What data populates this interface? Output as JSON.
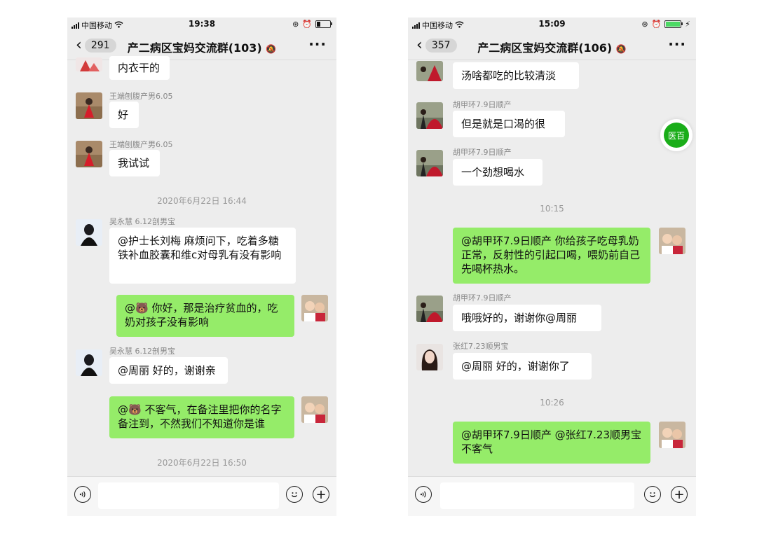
{
  "left": {
    "status": {
      "carrier": "中国移动",
      "time": "19:38"
    },
    "header": {
      "back_count": "291",
      "title": "产二病区宝妈交流群(103)"
    },
    "messages": [
      {
        "text": "内衣干的"
      },
      {
        "sender": "王端刨腹产男6.05",
        "text": "好"
      },
      {
        "sender": "王端刨腹产男6.05",
        "text": "我试试"
      },
      {
        "time": "2020年6月22日 16:44"
      },
      {
        "sender": "吴永慧  6.12剖男宝",
        "text": "@护士长刘梅 麻烦问下，吃着多糖铁补血胶囊和维c对母乳有没有影响"
      },
      {
        "text": "@🐻 你好，那是治疗贫血的，吃奶对孩子没有影响"
      },
      {
        "sender": "吴永慧  6.12剖男宝",
        "text": "@周丽 好的，谢谢亲"
      },
      {
        "text": "@🐻 不客气，在备注里把你的名字备注到，不然我们不知道你是谁"
      },
      {
        "time": "2020年6月22日 16:50"
      }
    ]
  },
  "right": {
    "status": {
      "carrier": "中国移动",
      "time": "15:09"
    },
    "header": {
      "back_count": "357",
      "title": "产二病区宝妈交流群(106)"
    },
    "float_button": "医百",
    "messages": [
      {
        "text": "汤啥都吃的比较清淡"
      },
      {
        "sender": "胡甲环7.9日顺产",
        "text": "但是就是口渴的很"
      },
      {
        "sender": "胡甲环7.9日顺产",
        "text": "一个劲想喝水"
      },
      {
        "time": "10:15"
      },
      {
        "text": "@胡甲环7.9日顺产 你给孩子吃母乳奶正常，反射性的引起口喝，喂奶前自己先喝杯热水。"
      },
      {
        "sender": "胡甲环7.9日顺产",
        "text": "哦哦好的，谢谢你@周丽"
      },
      {
        "sender": "张红7.23顺男宝",
        "text": "@周丽 好的，谢谢你了"
      },
      {
        "time": "10:26"
      },
      {
        "text": "@胡甲环7.9日顺产 @张红7.23顺男宝 不客气"
      }
    ]
  },
  "icons": {
    "voice": "voice-icon",
    "emoji": "emoji-icon",
    "plus": "plus-icon",
    "back": "chevron-left-icon",
    "more": "more-icon",
    "mute": "mute-bell-icon"
  },
  "colors": {
    "outgoing_bubble": "#95ec69",
    "incoming_bubble": "#ffffff",
    "chat_bg": "#ededed",
    "float_button": "#1aad19"
  }
}
